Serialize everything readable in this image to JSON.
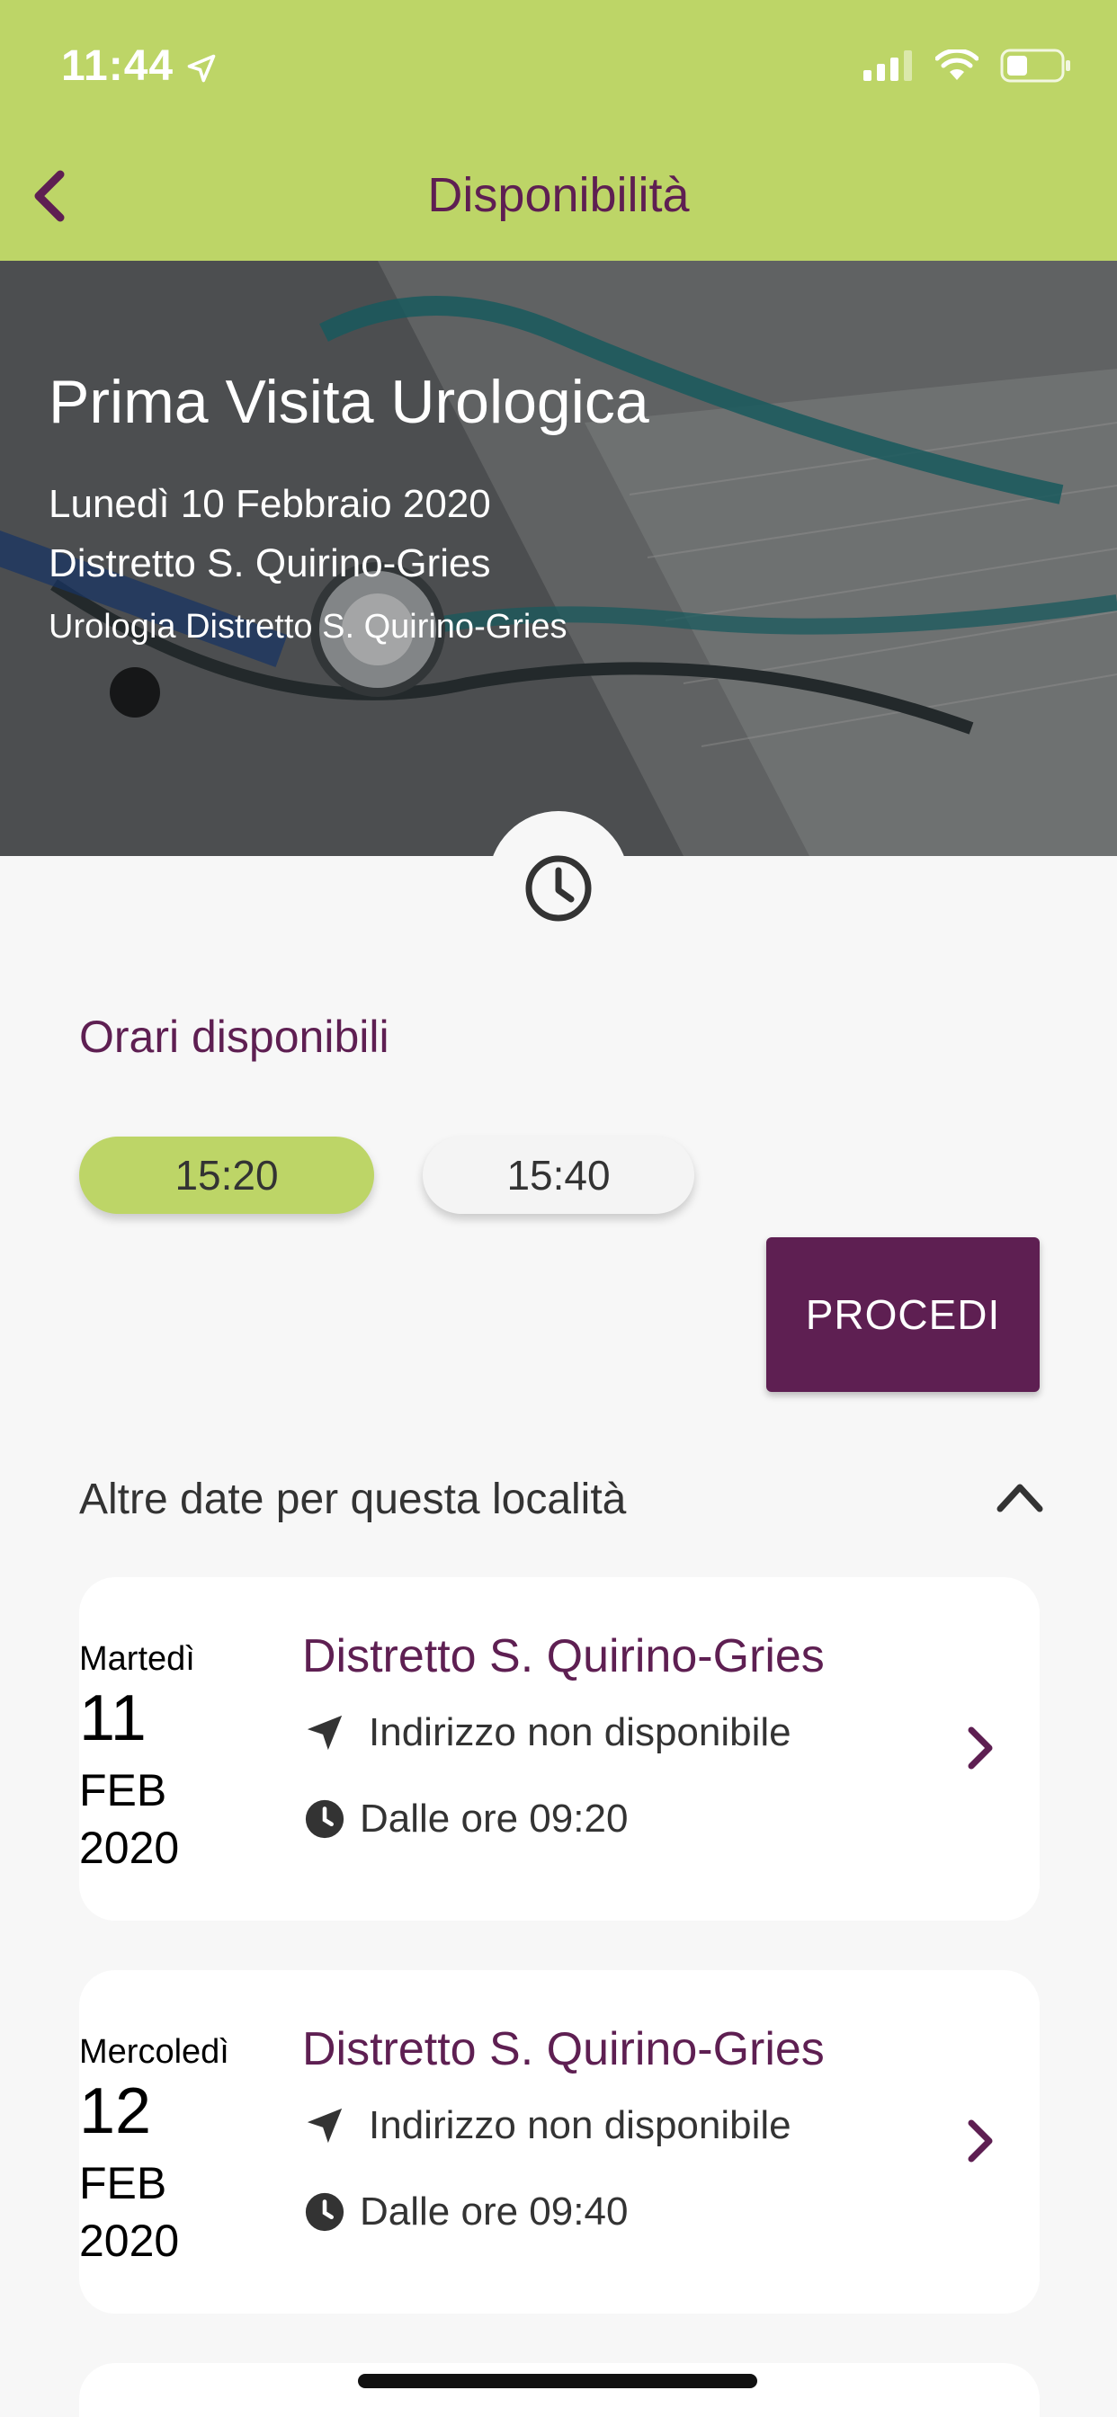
{
  "status_bar": {
    "time": "11:44",
    "icons": [
      "location-arrow-icon",
      "signal-icon",
      "wifi-icon",
      "battery-icon"
    ]
  },
  "nav": {
    "title": "Disponibilità",
    "back_icon": "chevron-left-icon"
  },
  "hero": {
    "title": "Prima Visita Urologica",
    "date": "Lunedì 10 Febbraio 2020",
    "district": "Distretto S. Quirino-Gries",
    "department": "Urologia Distretto S. Quirino-Gries"
  },
  "times": {
    "label": "Orari disponibili",
    "slots": [
      {
        "time": "15:20",
        "selected": true
      },
      {
        "time": "15:40",
        "selected": false
      }
    ]
  },
  "proceed_label": "PROCEDI",
  "other_dates": {
    "label": "Altre date per questa località",
    "items": [
      {
        "weekday": "Martedì",
        "day": "11",
        "month": "FEB",
        "year": "2020",
        "location": "Distretto S. Quirino-Gries",
        "address": "Indirizzo non disponibile",
        "time": "Dalle ore 09:20"
      },
      {
        "weekday": "Mercoledì",
        "day": "12",
        "month": "FEB",
        "year": "2020",
        "location": "Distretto S. Quirino-Gries",
        "address": "Indirizzo non disponibile",
        "time": "Dalle ore 09:40"
      }
    ]
  },
  "colors": {
    "brand": "#5e1f52",
    "accent": "#bdd567",
    "background": "#f7f7f7"
  }
}
